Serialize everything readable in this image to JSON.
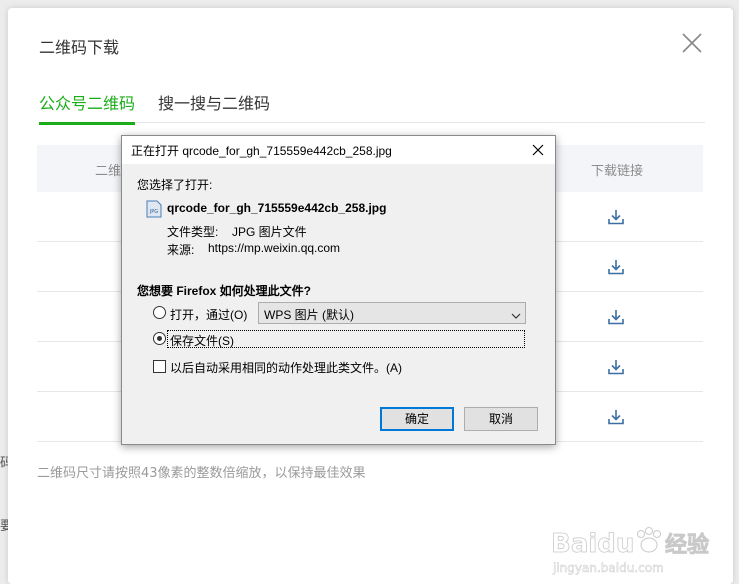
{
  "modal": {
    "title": "二维码下载",
    "tabs": [
      {
        "label": "公众号二维码",
        "active": true
      },
      {
        "label": "搜一搜与二维码",
        "active": false
      }
    ],
    "table": {
      "columns": [
        "二维",
        "下载链接"
      ],
      "rows": 5
    },
    "tip": "二维码尺寸请按照43像素的整数倍缩放，以保持最佳效果"
  },
  "background": {
    "hints": [
      "码",
      "要"
    ]
  },
  "dialog": {
    "title": "正在打开 qrcode_for_gh_715559e442cb_258.jpg",
    "you_chose": "您选择了打开:",
    "filename": "qrcode_for_gh_715559e442cb_258.jpg",
    "file_type_label": "文件类型:",
    "file_type_value": "JPG 图片文件",
    "source_label": "来源:",
    "source_value": "https://mp.weixin.qq.com",
    "question": "您想要 Firefox 如何处理此文件?",
    "open_with_label": "打开，通过(O)",
    "open_with_app": "WPS 图片 (默认)",
    "save_label": "保存文件(S)",
    "selected_option": "save",
    "auto_label": "以后自动采用相同的动作处理此类文件。(A)",
    "auto_checked": false,
    "ok_label": "确定",
    "cancel_label": "取消",
    "file_icon_text": "JPG"
  },
  "watermark": {
    "brand": "Baidu",
    "brand_cn": "经验",
    "url": "jingyan.baidu.com"
  },
  "colors": {
    "accent": "#1aad19",
    "focus": "#0078d7",
    "download_icon": "#3c6fa0"
  }
}
